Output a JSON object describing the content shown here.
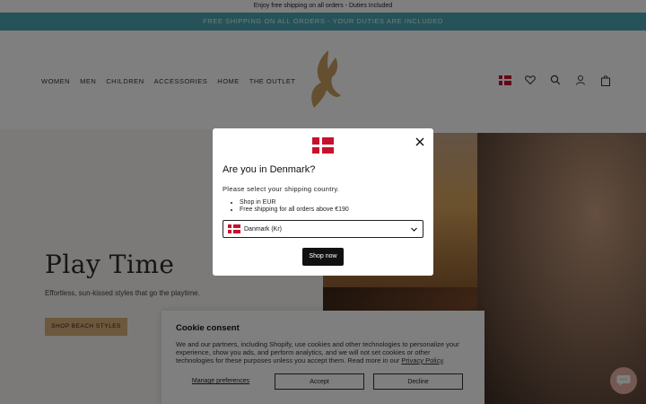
{
  "announcement": "Enjoy free shipping on all orders - Duties Included",
  "promo_bar": "FREE SHIPPING ON ALL ORDERS - YOUR DUTIES ARE INCLUDED",
  "nav": {
    "items": [
      "WOMEN",
      "MEN",
      "CHILDREN",
      "ACCESSORIES",
      "HOME",
      "THE OUTLET"
    ]
  },
  "header_icons": [
    "denmark-flag-icon",
    "heart-icon",
    "search-icon",
    "account-icon",
    "bag-icon"
  ],
  "hero": {
    "title": "Play Time",
    "subtitle": "Effortless, sun-kissed styles that go the playtime.",
    "button_label": "SHOP BEACH STYLES"
  },
  "cookie": {
    "title": "Cookie consent",
    "text": "We and our partners, including Shopify, use cookies and other technologies to personalize your experience, show you ads, and perform analytics, and we will not set cookies or other technologies for these purposes unless you accept them. Read more in our",
    "link": "Privacy Policy",
    "manage_label": "Manage preferences",
    "accept_label": "Accept",
    "decline_label": "Decline"
  },
  "modal": {
    "title": "Are you in Denmark?",
    "subtitle": "Please select your shipping country.",
    "bullets": [
      "Shop in EUR",
      "Free shipping for all orders above €190"
    ],
    "selected_country": "Danmark (Kr)",
    "button_label": "Shop now"
  },
  "colors": {
    "promo_bg": "#4aa7b3",
    "flag_red": "#c8102e",
    "button_dark": "#111111",
    "hero_button": "#d9b07a",
    "chat_bubble": "#e8b2a4"
  }
}
